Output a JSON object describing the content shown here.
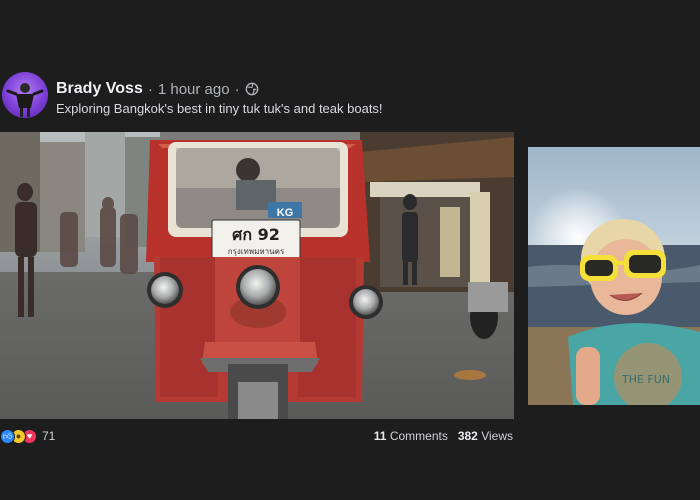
{
  "post": {
    "author": "Brady Voss",
    "separator": "·",
    "time": "1 hour ago",
    "separator2": "·",
    "caption": "Exploring Bangkok's best in tiny tuk tuk's and teak boats!",
    "privacy_icon": "globe-icon"
  },
  "photos": {
    "main": {
      "plate_top": "ศก 92",
      "plate_bottom": "กรุงเทพมหานคร",
      "sign": "KG"
    },
    "side": {
      "shirt_text": "THE FUN"
    }
  },
  "footer": {
    "reaction_icons": [
      "like-icon",
      "wow-icon",
      "love-icon"
    ],
    "reaction_count": "71",
    "comments_count": "11",
    "comments_label": "Comments",
    "views_count": "382",
    "views_label": "Views"
  },
  "colors": {
    "background": "#1d1d1e",
    "like": "#2d88ff",
    "wow": "#f7c92d",
    "love": "#f0365a"
  }
}
